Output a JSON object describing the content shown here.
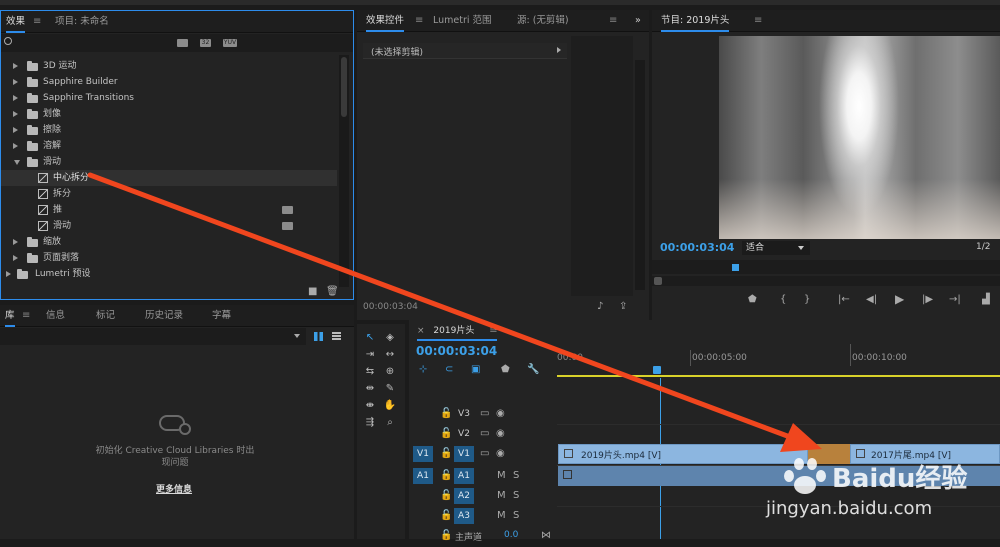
{
  "effects_panel": {
    "tabs": [
      "效果",
      "项目: 未命名"
    ],
    "tree": [
      {
        "label": "3D 运动",
        "expanded": false
      },
      {
        "label": "Sapphire Builder",
        "expanded": false
      },
      {
        "label": "Sapphire Transitions",
        "expanded": false
      },
      {
        "label": "划像",
        "expanded": false
      },
      {
        "label": "擦除",
        "expanded": false
      },
      {
        "label": "溶解",
        "expanded": false
      },
      {
        "label": "滑动",
        "expanded": true
      },
      {
        "label": "缩放",
        "expanded": false
      },
      {
        "label": "页面剥落",
        "expanded": false
      },
      {
        "label": "Lumetri 预设",
        "expanded": false
      }
    ],
    "children": [
      "中心拆分",
      "拆分",
      "推",
      "滑动"
    ],
    "filter_badges": [
      "",
      "32",
      "YUV"
    ]
  },
  "effect_controls": {
    "tabs": [
      "效果控件",
      "Lumetri 范围",
      "源: (无剪辑)"
    ],
    "no_clip": "(未选择剪辑)",
    "timecode": "00:00:03:04"
  },
  "program_monitor": {
    "title": "节目: 2019片头",
    "timecode": "00:00:03:04",
    "fit": "适合",
    "resolution": "1/2"
  },
  "library_panel": {
    "tabs": [
      "库",
      "信息",
      "标记",
      "历史记录",
      "字幕"
    ],
    "error_message_line1": "初始化 Creative Cloud Libraries 时出",
    "error_message_line2": "现问题",
    "more_info": "更多信息"
  },
  "timeline": {
    "sequence_name": "2019片头",
    "timecode": "00:00:03:04",
    "ruler": [
      "00:00",
      "00:00:05:00",
      "00:00:10:00"
    ],
    "tracks": [
      {
        "source": "",
        "name": "V3",
        "controls": [
          "",
          ""
        ]
      },
      {
        "source": "",
        "name": "V2",
        "controls": [
          "",
          ""
        ]
      },
      {
        "source": "V1",
        "name": "V1",
        "controls": [
          "",
          ""
        ]
      },
      {
        "source": "A1",
        "name": "A1",
        "controls": [
          "M",
          "S"
        ]
      },
      {
        "source": "",
        "name": "A2",
        "controls": [
          "M",
          "S"
        ]
      },
      {
        "source": "",
        "name": "A3",
        "controls": [
          "M",
          "S"
        ]
      }
    ],
    "master_label": "主声道",
    "master_value": "0.0",
    "clip1": "2019片头.mp4 [V]",
    "clip2": "2017片尾.mp4 [V]"
  },
  "watermark": {
    "text": "Baidu经验",
    "url": "jingyan.baidu.com"
  },
  "colors": {
    "accent": "#2d8ceb",
    "timecode": "#3ca0e8",
    "clip": "#8cb6e0",
    "arrow": "#f0461e",
    "transition": "#b8813c"
  }
}
